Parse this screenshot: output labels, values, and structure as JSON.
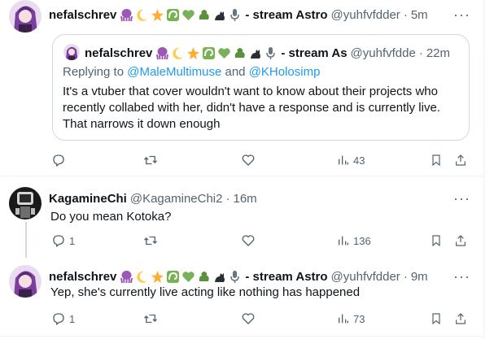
{
  "tweets": [
    {
      "name": "nefalschrev",
      "emojis": [
        "octopus",
        "moon",
        "star",
        "swirl",
        "heart",
        "dragon",
        "cat",
        "mic"
      ],
      "suffix": "- stream Astro",
      "handle": "@yuhfvfdder",
      "sep": "·",
      "time": "5m",
      "quote": {
        "name": "nefalschrev",
        "suffix": "- stream As",
        "handle": "@yuhfvfdde",
        "sep": "·",
        "time": "22m",
        "replying_prefix": "Replying to",
        "replying_user1": "@MaleMultimuse",
        "replying_and": "and",
        "replying_user2": "@KHolosimp",
        "text": "It's a vtuber that cover wouldn't want to know about their projects who recently collabed with her, didn't have a response and is currently live. That narrows it down enough"
      },
      "views": "43"
    },
    {
      "name": "KagamineChi",
      "handle": "@KagamineChi2",
      "sep": "·",
      "time": "16m",
      "text": "Do you mean Kotoka?",
      "replies": "1",
      "views": "136"
    },
    {
      "name": "nefalschrev",
      "suffix": "- stream Astro",
      "handle": "@yuhfvfdder",
      "sep": "·",
      "time": "9m",
      "text": "Yep, she's currently live acting like nothing has happened",
      "replies": "1",
      "views": "73"
    }
  ],
  "more_label": "···",
  "colors": {
    "text": "#0f1419",
    "muted": "#536471",
    "link": "#1d9bf0",
    "border": "#cfd9de"
  }
}
